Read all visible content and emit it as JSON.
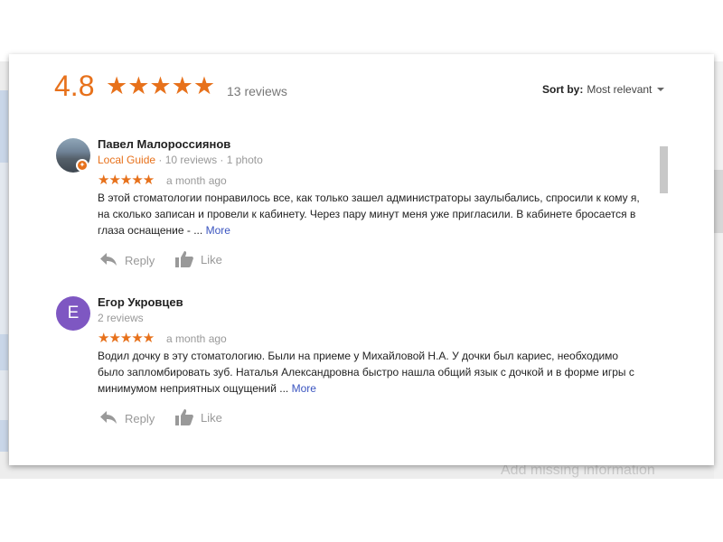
{
  "summary": {
    "rating": "4.8",
    "stars": "★★★★★",
    "review_count": "13 reviews"
  },
  "sort": {
    "label": "Sort by:",
    "value": "Most relevant"
  },
  "reviews": [
    {
      "name": "Павел Малороссиянов",
      "badge": "Local Guide",
      "meta": " · 10 reviews · 1 photo",
      "stars": "★★★★★",
      "date": "a month ago",
      "text": "В этой стоматологии понравилось все, как только зашел администраторы заулыбались, спросили к кому я, на сколько записан и провели к кабинету. Через пару минут меня уже пригласили. В кабинете бросается в глаза оснащение - ...",
      "more": "More",
      "reply": "Reply",
      "like": "Like"
    },
    {
      "name": "Егор Укровцев",
      "avatar_letter": "E",
      "meta": "2 reviews",
      "stars": "★★★★★",
      "date": "a month ago",
      "text": "Водил дочку в эту стоматологию. Были на приеме у Михайловой Н.А. У дочки был кариес, необходимо было запломбировать зуб. Наталья Александровна быстро нашла общий язык с дочкой и в форме игры с минимумом неприятных ощущений ...",
      "more": "More",
      "reply": "Reply",
      "like": "Like"
    }
  ],
  "background": {
    "add_missing": "Add missing information"
  },
  "colors": {
    "accent": "#e7711b",
    "link": "#3b55c0",
    "avatar_letter_bg": "#7e57c2"
  },
  "icons": [
    "star-icon",
    "caret-down-icon",
    "reply-arrow-icon",
    "thumbs-up-icon",
    "local-guide-badge-icon"
  ]
}
